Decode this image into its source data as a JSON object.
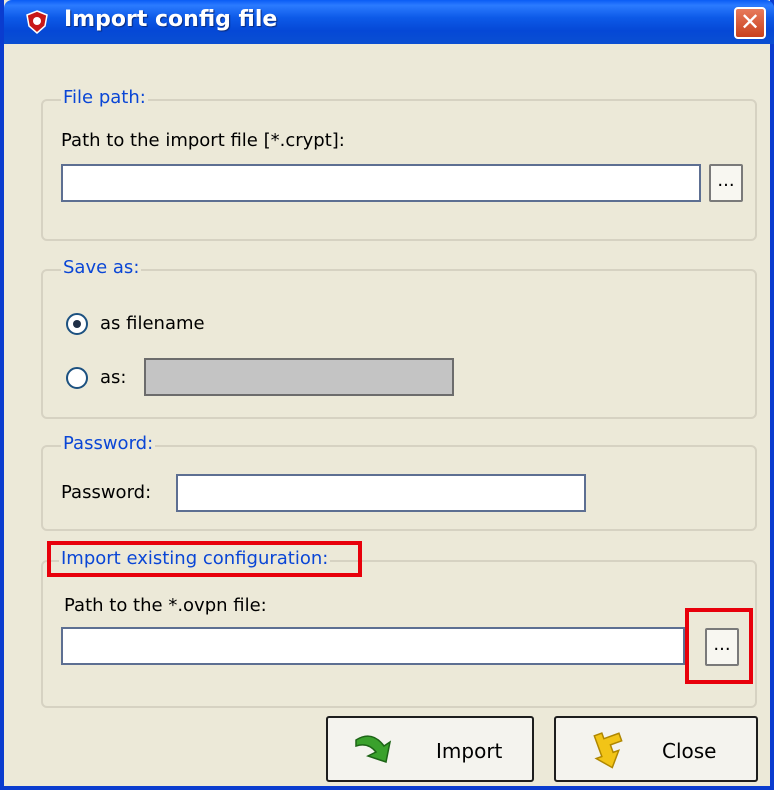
{
  "window": {
    "title": "Import config file",
    "close_glyph": "✕"
  },
  "file_path_group": {
    "legend": "File path:",
    "label": "Path to the import file [*.crypt]:",
    "value": "",
    "browse_label": "..."
  },
  "save_as_group": {
    "legend": "Save as:",
    "option_filename": "as filename",
    "option_as": "as:",
    "selected": "as filename",
    "as_value": ""
  },
  "password_group": {
    "legend": "Password:",
    "label": "Password:",
    "value": ""
  },
  "import_existing_group": {
    "legend": "Import existing configuration:",
    "label": "Path to the *.ovpn file:",
    "value": "",
    "browse_label": "..."
  },
  "buttons": {
    "import_label": "Import",
    "close_label": "Close"
  },
  "colors": {
    "accent_blue": "#0a46d6",
    "highlight_red": "#e8000b",
    "title_bar": "#0548d6",
    "dialog_bg": "#ece9d8"
  },
  "icons": {
    "title": "shield-icon",
    "import": "green-arrow-icon",
    "close": "yellow-arrow-icon"
  }
}
